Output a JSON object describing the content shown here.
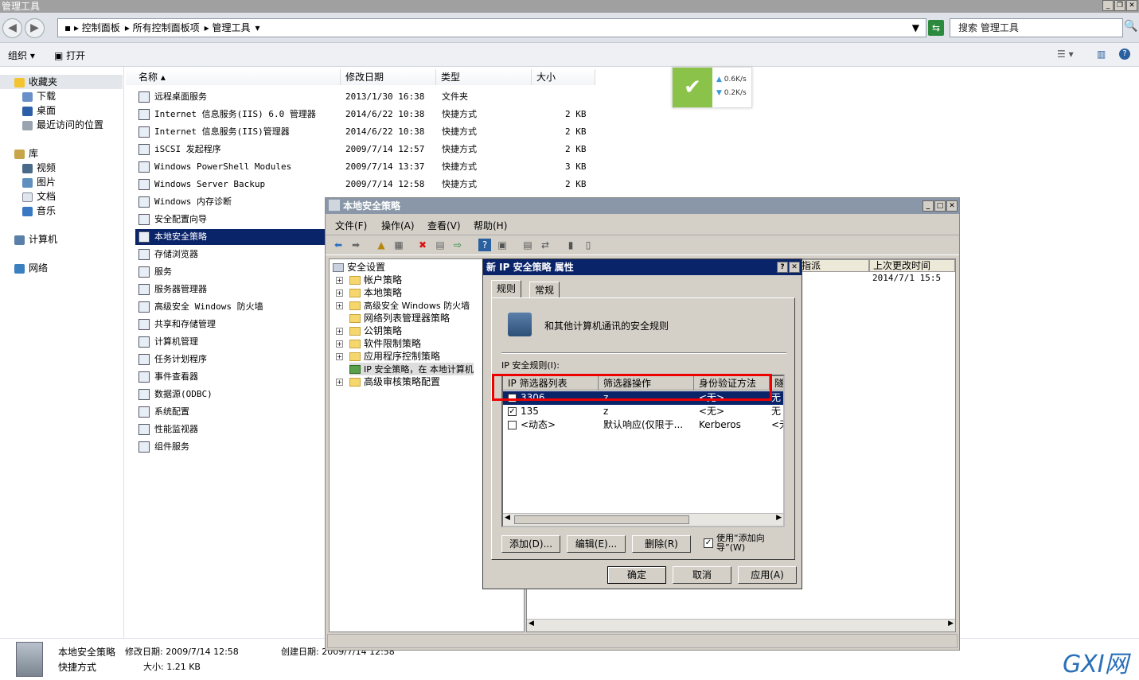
{
  "window": {
    "title": "管理工具"
  },
  "address": {
    "segments": [
      "控制面板",
      "所有控制面板项",
      "管理工具"
    ],
    "search_placeholder": "搜索 管理工具"
  },
  "commands": {
    "organize": "组织",
    "open": "打开"
  },
  "nav": {
    "favorites": "收藏夹",
    "downloads": "下载",
    "desktop": "桌面",
    "recent": "最近访问的位置",
    "libraries": "库",
    "videos": "视频",
    "pictures": "图片",
    "documents": "文档",
    "music": "音乐",
    "computer": "计算机",
    "network": "网络"
  },
  "columns": {
    "name": "名称",
    "modified": "修改日期",
    "type": "类型",
    "size": "大小"
  },
  "files": [
    {
      "name": "远程桌面服务",
      "date": "2013/1/30 16:38",
      "type": "文件夹",
      "size": ""
    },
    {
      "name": "Internet 信息服务(IIS) 6.0 管理器",
      "date": "2014/6/22 10:38",
      "type": "快捷方式",
      "size": "2 KB"
    },
    {
      "name": "Internet 信息服务(IIS)管理器",
      "date": "2014/6/22 10:38",
      "type": "快捷方式",
      "size": "2 KB"
    },
    {
      "name": "iSCSI 发起程序",
      "date": "2009/7/14 12:57",
      "type": "快捷方式",
      "size": "2 KB"
    },
    {
      "name": "Windows PowerShell Modules",
      "date": "2009/7/14 13:37",
      "type": "快捷方式",
      "size": "3 KB"
    },
    {
      "name": "Windows Server Backup",
      "date": "2009/7/14 12:58",
      "type": "快捷方式",
      "size": "2 KB"
    },
    {
      "name": "Windows 内存诊断",
      "date": "",
      "type": "",
      "size": ""
    },
    {
      "name": "安全配置向导",
      "date": "",
      "type": "",
      "size": ""
    },
    {
      "name": "本地安全策略",
      "date": "",
      "type": "",
      "size": ""
    },
    {
      "name": "存储浏览器",
      "date": "",
      "type": "",
      "size": ""
    },
    {
      "name": "服务",
      "date": "",
      "type": "",
      "size": ""
    },
    {
      "name": "服务器管理器",
      "date": "",
      "type": "",
      "size": ""
    },
    {
      "name": "高级安全 Windows 防火墙",
      "date": "",
      "type": "",
      "size": ""
    },
    {
      "name": "共享和存储管理",
      "date": "",
      "type": "",
      "size": ""
    },
    {
      "name": "计算机管理",
      "date": "",
      "type": "",
      "size": ""
    },
    {
      "name": "任务计划程序",
      "date": "",
      "type": "",
      "size": ""
    },
    {
      "name": "事件查看器",
      "date": "",
      "type": "",
      "size": ""
    },
    {
      "name": "数据源(ODBC)",
      "date": "",
      "type": "",
      "size": ""
    },
    {
      "name": "系统配置",
      "date": "",
      "type": "",
      "size": ""
    },
    {
      "name": "性能监视器",
      "date": "",
      "type": "",
      "size": ""
    },
    {
      "name": "组件服务",
      "date": "",
      "type": "",
      "size": ""
    }
  ],
  "speed": {
    "up": "0.6K/s",
    "down": "0.2K/s"
  },
  "status": {
    "name": "本地安全策略",
    "modified_label": "修改日期: 2009/7/14 12:58",
    "created_label": "创建日期: 2009/7/14 12:58",
    "type": "快捷方式",
    "size_label": "大小: 1.21 KB"
  },
  "lsp": {
    "title": "本地安全策略",
    "menu": [
      "文件(F)",
      "操作(A)",
      "查看(V)",
      "帮助(H)"
    ],
    "tree": [
      "安全设置",
      "帐户策略",
      "本地策略",
      "高级安全 Windows 防火墙",
      "网络列表管理器策略",
      "公钥策略",
      "软件限制策略",
      "应用程序控制策略",
      "IP 安全策略，在 本地计算机",
      "高级审核策略配置"
    ],
    "right_columns": [
      "指派",
      "上次更改时间"
    ],
    "right_value": "2014/7/1 15:5"
  },
  "dialog": {
    "title": "新 IP 安全策略 属性",
    "tabs": [
      "规则",
      "常规"
    ],
    "description": "和其他计算机通讯的安全规则",
    "rules_label": "IP 安全规则(I):",
    "rule_columns": [
      "IP 筛选器列表",
      "筛选器操作",
      "身份验证方法",
      "隧"
    ],
    "rules": [
      {
        "checked": false,
        "list": "3306",
        "action": "z",
        "auth": "<无>",
        "tunnel": "无"
      },
      {
        "checked": true,
        "list": "135",
        "action": "z",
        "auth": "<无>",
        "tunnel": "无"
      },
      {
        "checked": false,
        "list": "<动态>",
        "action": "默认响应(仅限于...",
        "auth": "Kerberos",
        "tunnel": "<无"
      }
    ],
    "add": "添加(D)...",
    "edit": "编辑(E)...",
    "remove": "删除(R)",
    "wizard": "使用“添加向导”(W)",
    "ok": "确定",
    "cancel": "取消",
    "apply": "应用(A)"
  },
  "watermark": "GXI网"
}
